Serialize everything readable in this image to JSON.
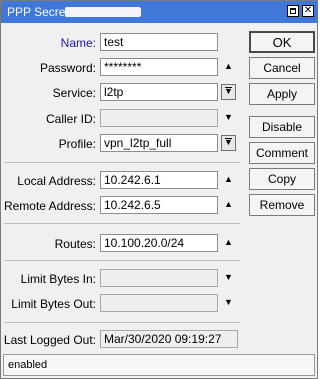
{
  "window": {
    "title": "PPP Secret"
  },
  "form": {
    "name": {
      "label": "Name:",
      "value": "test"
    },
    "password": {
      "label": "Password:",
      "value": "********"
    },
    "service": {
      "label": "Service:",
      "value": "l2tp"
    },
    "caller_id": {
      "label": "Caller ID:",
      "value": ""
    },
    "profile": {
      "label": "Profile:",
      "value": "vpn_l2tp_full"
    },
    "local_address": {
      "label": "Local Address:",
      "value": "10.242.6.1"
    },
    "remote_address": {
      "label": "Remote Address:",
      "value": "10.242.6.5"
    },
    "routes": {
      "label": "Routes:",
      "value": "10.100.20.0/24"
    },
    "limit_bytes_in": {
      "label": "Limit Bytes In:",
      "value": ""
    },
    "limit_bytes_out": {
      "label": "Limit Bytes Out:",
      "value": ""
    },
    "last_logged_out": {
      "label": "Last Logged Out:",
      "value": "Mar/30/2020 09:19:27"
    }
  },
  "buttons": {
    "ok": "OK",
    "cancel": "Cancel",
    "apply": "Apply",
    "disable": "Disable",
    "comment": "Comment",
    "copy": "Copy",
    "remove": "Remove"
  },
  "status": {
    "text": "enabled"
  },
  "icons": {
    "up": "up-arrow-icon",
    "down": "down-arrow-icon",
    "dropdown": "dropdown-icon"
  }
}
